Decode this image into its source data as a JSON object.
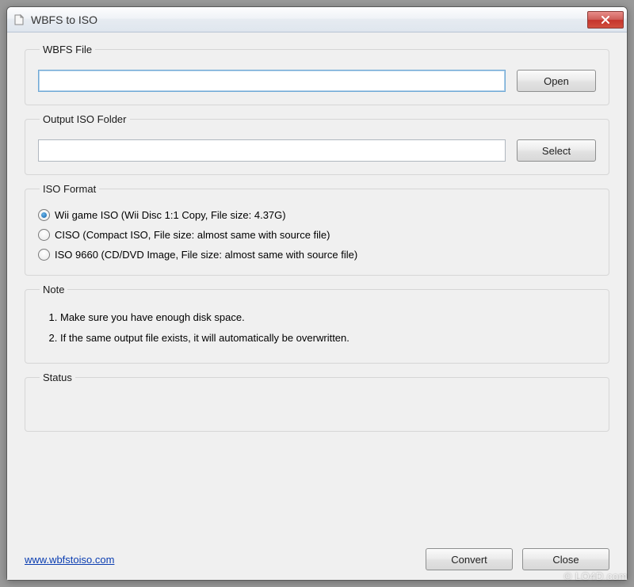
{
  "window": {
    "title": "WBFS to ISO"
  },
  "wbfs": {
    "legend": "WBFS File",
    "value": "",
    "open_label": "Open"
  },
  "output": {
    "legend": "Output ISO Folder",
    "value": "",
    "select_label": "Select"
  },
  "iso_format": {
    "legend": "ISO Format",
    "options": [
      {
        "label": "Wii game ISO (Wii Disc 1:1 Copy, File size: 4.37G)",
        "checked": true
      },
      {
        "label": "CISO (Compact ISO, File size: almost same with source file)",
        "checked": false
      },
      {
        "label": "ISO 9660 (CD/DVD Image, File size: almost same with source file)",
        "checked": false
      }
    ]
  },
  "note": {
    "legend": "Note",
    "items": [
      "Make sure you have enough disk space.",
      "If the same output file exists, it will automatically be overwritten."
    ]
  },
  "status": {
    "legend": "Status",
    "text": ""
  },
  "footer": {
    "link_text": "www.wbfstoiso.com",
    "convert_label": "Convert",
    "close_label": "Close"
  },
  "watermark": "© LO4D.com"
}
